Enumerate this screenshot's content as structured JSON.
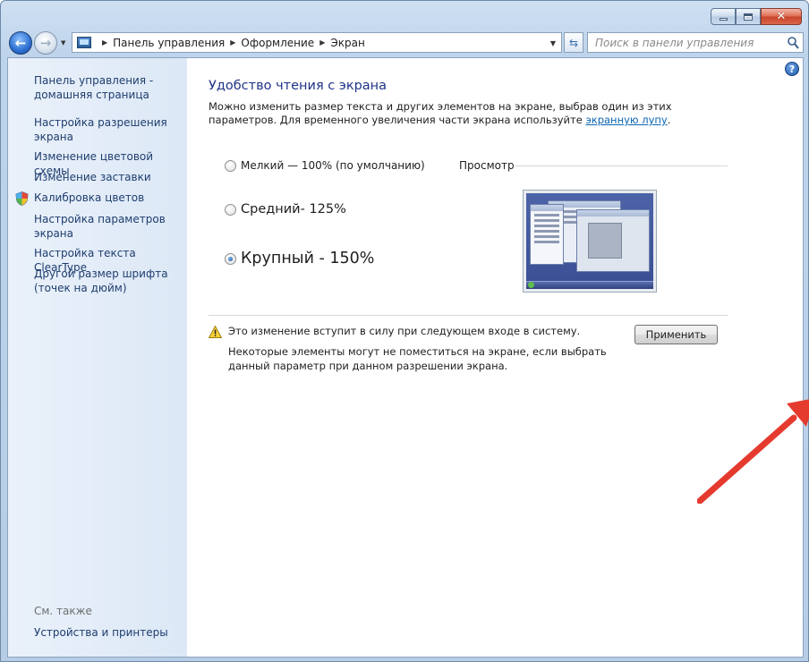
{
  "breadcrumb": {
    "items": [
      "Панель управления",
      "Оформление",
      "Экран"
    ]
  },
  "search": {
    "placeholder": "Поиск в панели управления"
  },
  "sidebar": {
    "links": [
      "Панель управления - домашняя страница",
      "Настройка разрешения экрана",
      "Изменение цветовой схемы",
      "Изменение заставки",
      "Калибровка цветов",
      "Настройка параметров экрана",
      "Настройка текста ClearType",
      "Другой размер шрифта (точек на дюйм)"
    ],
    "see_also_title": "См. также",
    "see_also_links": [
      "Устройства и принтеры"
    ]
  },
  "main": {
    "heading": "Удобство чтения с экрана",
    "description": "Можно изменить размер текста и других элементов на экране, выбрав один из этих параметров. Для временного увеличения части экрана используйте ",
    "description_link": "экранную лупу",
    "description_end": ".",
    "options": [
      {
        "label": "Мелкий — 100% (по умолчанию)",
        "checked": false
      },
      {
        "label": "Средний- 125%",
        "checked": false
      },
      {
        "label": "Крупный - 150%",
        "checked": true
      }
    ],
    "preview_label": "Просмотр",
    "warning": "Это изменение вступит в силу при следующем входе в систему.",
    "note": "Некоторые элементы могут не поместиться на экране, если выбрать данный параметр при данном разрешении экрана.",
    "apply_label": "Применить"
  },
  "colors": {
    "heading": "#1e3287",
    "link": "#0c66b3",
    "arrow": "#e53a2e"
  }
}
